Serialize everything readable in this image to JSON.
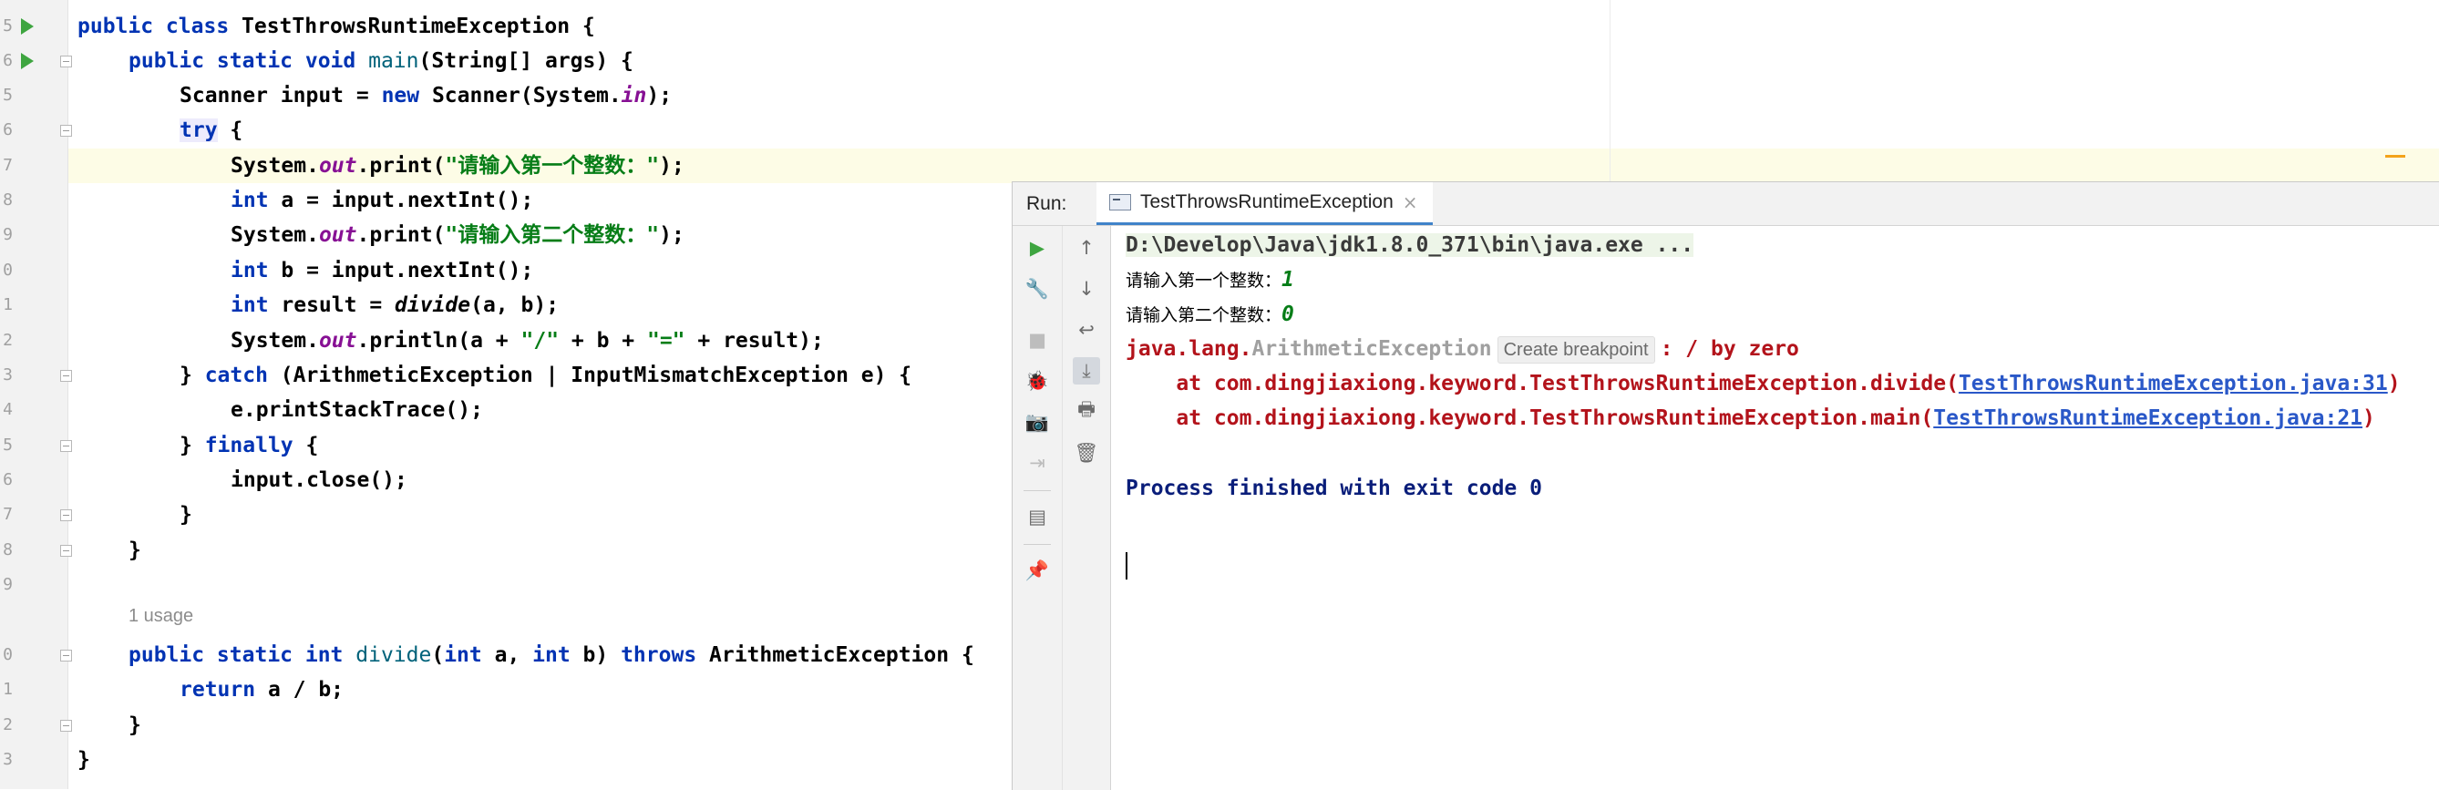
{
  "editor": {
    "line_numbers": [
      "5",
      "6",
      "5",
      "6",
      "7",
      "8",
      "9",
      "0",
      "1",
      "2",
      "3",
      "4",
      "5",
      "6",
      "7",
      "8",
      "9",
      "",
      "0",
      "1",
      "2",
      "3"
    ],
    "usage_hint": "1 usage"
  },
  "code": {
    "l1": {
      "a": "public class ",
      "b": "TestThrowsRuntimeException {"
    },
    "l2": {
      "a": "public static void ",
      "b": "main",
      "c": "(String[] args) {"
    },
    "l3": {
      "a": "Scanner input = ",
      "b": "new ",
      "c": "Scanner(System.",
      "d": "in",
      "e": ");"
    },
    "l4": {
      "a": "try",
      "b": " {"
    },
    "l5": {
      "a": "System.",
      "b": "out",
      "c": ".print(",
      "d": "\"请输入第一个整数：\"",
      "e": ");"
    },
    "l6": {
      "a": "int ",
      "b": "a = input.nextInt();"
    },
    "l7": {
      "a": "System.",
      "b": "out",
      "c": ".print(",
      "d": "\"请输入第二个整数：\"",
      "e": ");"
    },
    "l8": {
      "a": "int ",
      "b": "b = input.nextInt();"
    },
    "l9": {
      "a": "int ",
      "b": "result = ",
      "c": "divide",
      "d": "(a, b);"
    },
    "l10": {
      "a": "System.",
      "b": "out",
      "c": ".println(a + ",
      "d": "\"/\"",
      "e": " + b + ",
      "f": "\"=\"",
      "g": " + result);"
    },
    "l11": {
      "a": "} ",
      "b": "catch",
      "c": " (ArithmeticException | InputMismatchException e) {"
    },
    "l12": {
      "a": "e.printStackTrace();"
    },
    "l13": {
      "a": "} ",
      "b": "finally",
      "c": " {"
    },
    "l14": {
      "a": "input.close();"
    },
    "l15": {
      "a": "}"
    },
    "l16": {
      "a": "}"
    },
    "l17": {
      "a": "public static int ",
      "b": "divide",
      "c": "(",
      "d": "int ",
      "e": "a, ",
      "f": "int ",
      "g": "b) ",
      "h": "throws ",
      "i": "ArithmeticException {"
    },
    "l18": {
      "a": "return ",
      "b": "a / b;"
    },
    "l19": {
      "a": "}"
    },
    "l20": {
      "a": "}"
    }
  },
  "run_panel": {
    "label": "Run:",
    "tab_label": "TestThrowsRuntimeException",
    "tab_close": "×",
    "console": {
      "cmd": "D:\\Develop\\Java\\jdk1.8.0_371\\bin\\java.exe ...",
      "prompt1": "请输入第一个整数：",
      "input1": "1",
      "prompt2": "请输入第二个整数：",
      "input2": "0",
      "exc_prefix": "java.lang.",
      "exc_name": "ArithmeticException",
      "breakpoint_chip": "Create breakpoint",
      "exc_msg": ": / by zero",
      "trace1_prefix": "    at com.dingjiaxiong.keyword.TestThrowsRuntimeException.divide(",
      "trace1_link": "TestThrowsRuntimeException.java:31",
      "trace1_suffix": ")",
      "trace2_prefix": "    at com.dingjiaxiong.keyword.TestThrowsRuntimeException.main(",
      "trace2_link": "TestThrowsRuntimeException.java:21",
      "trace2_suffix": ")",
      "finished": "Process finished with exit code 0"
    }
  },
  "icons": {
    "rerun": "▶",
    "settings": "🔧",
    "stop": "■",
    "debug": "🐞",
    "screenshot": "📷",
    "login": "⇥",
    "layout": "▤",
    "pin": "📌",
    "up": "↑",
    "down": "↓",
    "wrap": "↩",
    "scroll_end": "⤓",
    "print": "🖶",
    "trash": "🗑"
  },
  "colors": {
    "keyword": "#0033b3",
    "string": "#067d17",
    "error": "#b3131b",
    "link": "#2a58c8",
    "accent_tab": "#4083c9",
    "run_green": "#3ea540"
  }
}
